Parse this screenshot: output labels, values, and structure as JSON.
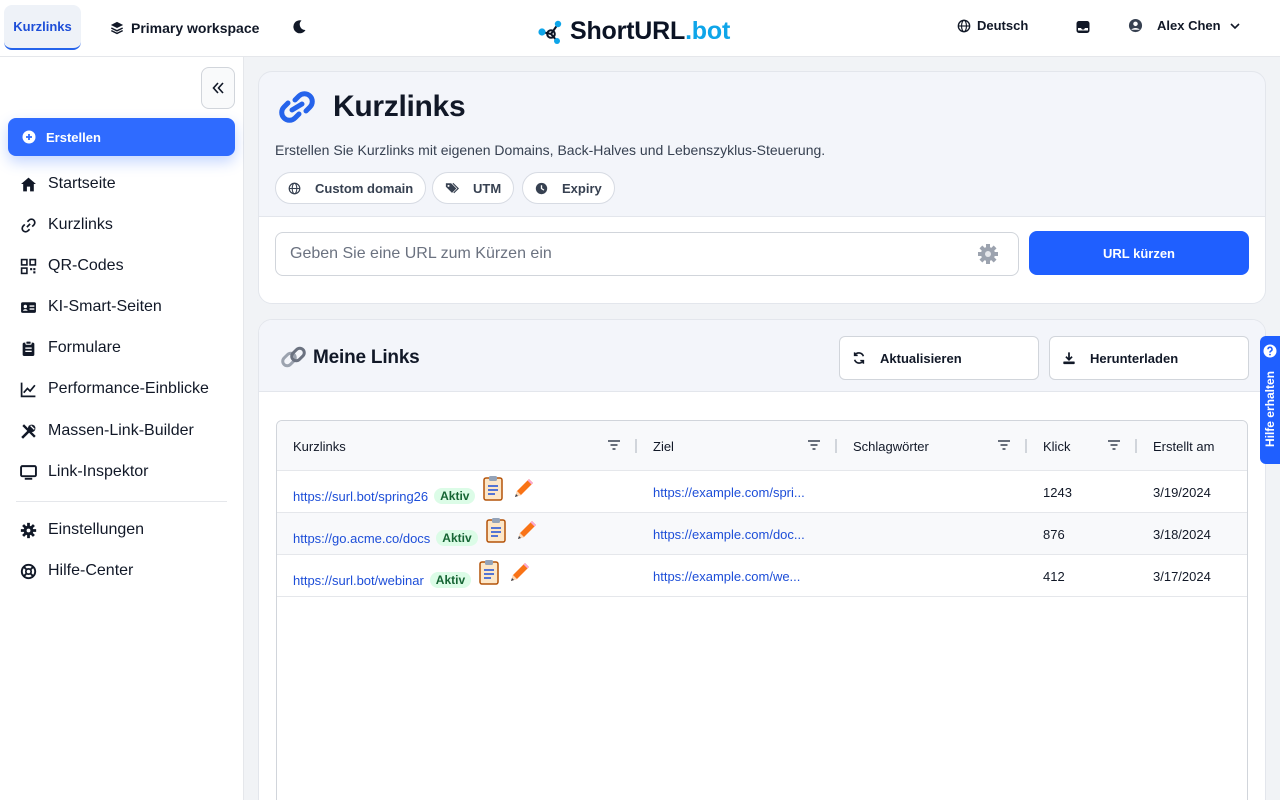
{
  "topbar": {
    "active_tab": "Kurzlinks",
    "workspace": "Primary workspace",
    "logo_main": "ShortURL",
    "logo_accent": ".bot",
    "language": "Deutsch",
    "user_name": "Alex Chen"
  },
  "sidebar": {
    "create": "Erstellen",
    "items": [
      "Startseite",
      "Kurzlinks",
      "QR-Codes",
      "KI-Smart-Seiten",
      "Formulare",
      "Performance-Einblicke",
      "Massen-Link-Builder",
      "Link-Inspektor"
    ],
    "bottom_items": [
      "Einstellungen",
      "Hilfe-Center"
    ]
  },
  "hero": {
    "title": "Kurzlinks",
    "description": "Erstellen Sie Kurzlinks mit eigenen Domains, Back-Halves und Lebenszyklus-Steuerung.",
    "chips": [
      "Custom domain",
      "UTM",
      "Expiry"
    ],
    "input_placeholder": "Geben Sie eine URL zum Kürzen ein",
    "submit": "URL kürzen"
  },
  "links": {
    "title": "Meine Links",
    "refresh": "Aktualisieren",
    "download": "Herunterladen",
    "columns": [
      "Kurzlinks",
      "Ziel",
      "Schlagwörter",
      "Klick",
      "Erstellt am"
    ],
    "rows": [
      {
        "short": "https://surl.bot/spring26",
        "status": "Aktiv",
        "target": "https://example.com/spri...",
        "tags": "",
        "clicks": "1243",
        "created": "3/19/2024"
      },
      {
        "short": "https://go.acme.co/docs",
        "status": "Aktiv",
        "target": "https://example.com/doc...",
        "tags": "",
        "clicks": "876",
        "created": "3/18/2024"
      },
      {
        "short": "https://surl.bot/webinar",
        "status": "Aktiv",
        "target": "https://example.com/we...",
        "tags": "",
        "clicks": "412",
        "created": "3/17/2024"
      }
    ]
  },
  "help_tab": "Hilfe erhalten",
  "colors": {
    "primary": "#1f5fff",
    "active_badge_bg": "#dcfce7",
    "active_badge_text": "#166534",
    "link": "#1d4ed8"
  }
}
